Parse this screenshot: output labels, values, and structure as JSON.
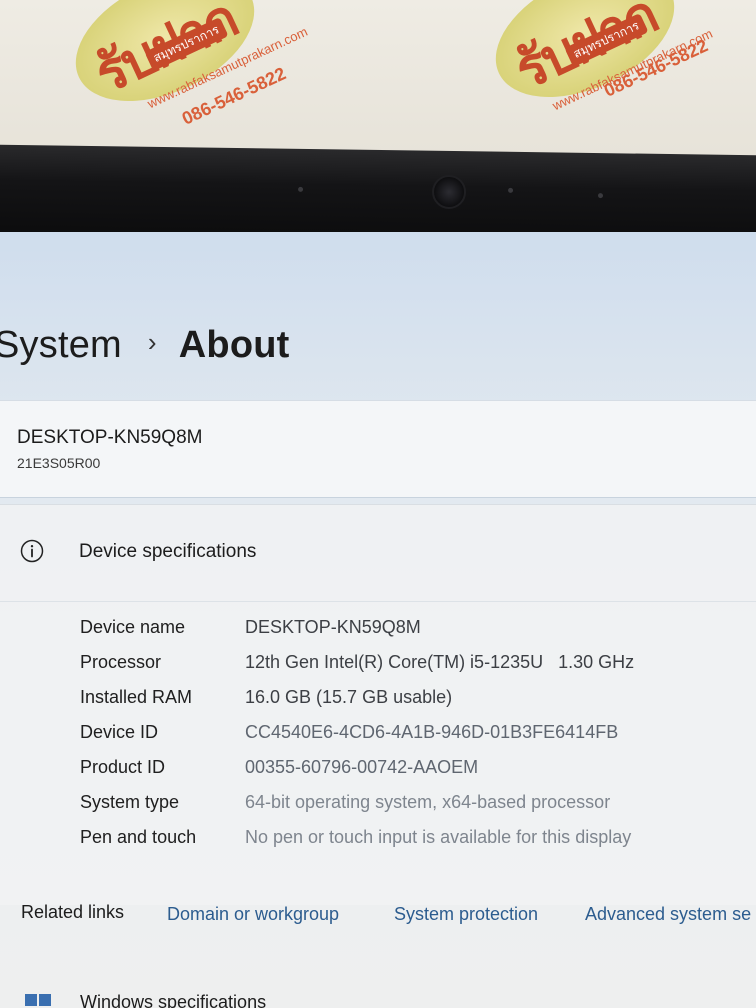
{
  "backdrop": {
    "stickers": [
      {
        "logo": "รับฝาก",
        "sub": "สมุทรปราการ",
        "url": "www.rabfaksamutprakarn.com",
        "phone": "086-546-5822"
      },
      {
        "logo": "รับฝาก",
        "sub": "สมุทรปราการ",
        "url": "www.rabfaksamutprakarn.com",
        "phone": "086-546-5822"
      }
    ]
  },
  "breadcrumb": {
    "parent": "System",
    "separator": "›",
    "current": "About"
  },
  "device": {
    "name": "DESKTOP-KN59Q8M",
    "model": "21E3S05R00"
  },
  "specs": {
    "title": "Device specifications",
    "icon": "info-icon",
    "rows": [
      {
        "label": "Device name",
        "value": "DESKTOP-KN59Q8M"
      },
      {
        "label": "Processor",
        "value": "12th Gen Intel(R) Core(TM) i5-1235U   1.30 GHz"
      },
      {
        "label": "Installed RAM",
        "value": "16.0 GB (15.7 GB usable)"
      },
      {
        "label": "Device ID",
        "value": "CC4540E6-4CD6-4A1B-946D-01B3FE6414FB"
      },
      {
        "label": "Product ID",
        "value": "00355-60796-00742-AAOEM"
      },
      {
        "label": "System type",
        "value": "64-bit operating system, x64-based processor"
      },
      {
        "label": "Pen and touch",
        "value": "No pen or touch input is available for this display"
      }
    ]
  },
  "related": {
    "label": "Related links",
    "links": [
      "Domain or workgroup",
      "System protection",
      "Advanced system se"
    ]
  },
  "windows_specs": {
    "label": "Windows specifications",
    "icon": "windows-icon"
  },
  "colors": {
    "link": "#2c5c8f",
    "accent_sticker": "#c74a2a"
  }
}
